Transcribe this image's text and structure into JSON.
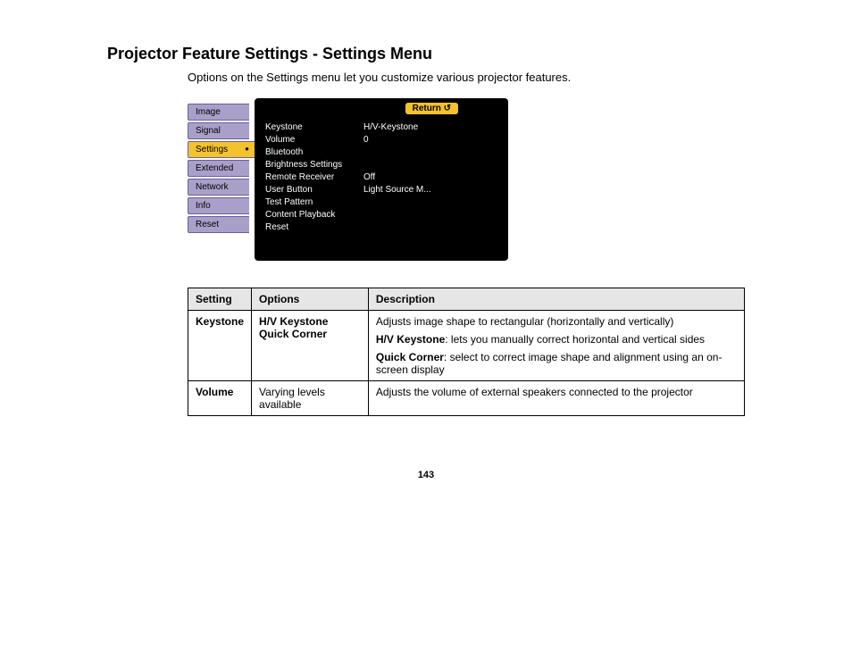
{
  "title": "Projector Feature Settings - Settings Menu",
  "intro": "Options on the Settings menu let you customize various projector features.",
  "menu": {
    "tabs": [
      {
        "label": "Image",
        "active": false
      },
      {
        "label": "Signal",
        "active": false
      },
      {
        "label": "Settings",
        "active": true
      },
      {
        "label": "Extended",
        "active": false
      },
      {
        "label": "Network",
        "active": false
      },
      {
        "label": "Info",
        "active": false
      },
      {
        "label": "Reset",
        "active": false
      }
    ],
    "return": "Return",
    "items": [
      {
        "label": "Keystone",
        "value": "H/V-Keystone"
      },
      {
        "label": "Volume",
        "value": "0"
      },
      {
        "label": "Bluetooth",
        "value": ""
      },
      {
        "label": "Brightness Settings",
        "value": ""
      },
      {
        "label": "Remote Receiver",
        "value": "Off"
      },
      {
        "label": "User Button",
        "value": "Light Source M..."
      },
      {
        "label": "Test Pattern",
        "value": ""
      },
      {
        "label": "Content Playback",
        "value": ""
      },
      {
        "label": "Reset",
        "value": ""
      }
    ]
  },
  "table": {
    "headers": [
      "Setting",
      "Options",
      "Description"
    ],
    "rows": [
      {
        "setting": "Keystone",
        "options": [
          "H/V Keystone",
          "Quick Corner"
        ],
        "desc": {
          "main": "Adjusts image shape to rectangular (horizontally and vertically)",
          "hv_label": "H/V Keystone",
          "hv_text": ": lets you manually correct horizontal and vertical sides",
          "qc_label": "Quick Corner",
          "qc_text": ": select to correct image shape and alignment using an on-screen display"
        }
      },
      {
        "setting": "Volume",
        "options_text": "Varying levels available",
        "desc_text": "Adjusts the volume of external speakers connected to the projector"
      }
    ]
  },
  "page_number": "143"
}
